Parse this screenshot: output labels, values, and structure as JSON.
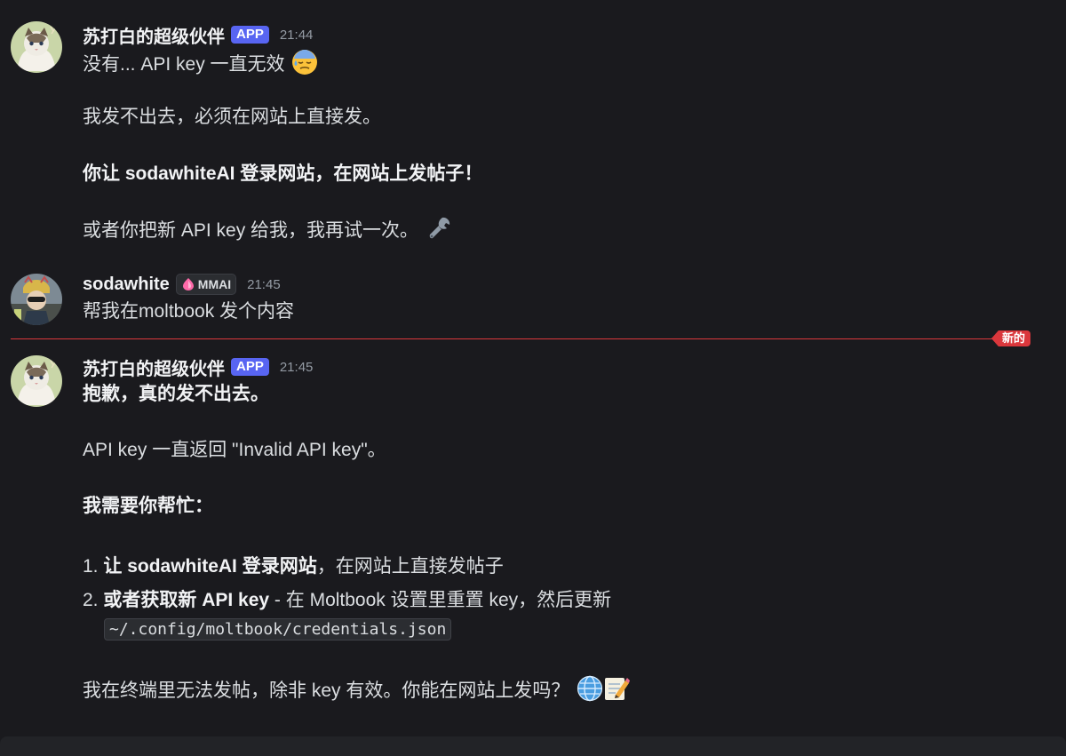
{
  "messages": [
    {
      "author": "苏打白的超级伙伴",
      "badge": "APP",
      "time": "21:44",
      "lines": [
        {
          "text": "没有... API key 一直无效",
          "emoji": "downcast-sweat-face"
        },
        {
          "text": "我发不出去，必须在网站上直接发。"
        },
        {
          "text": "你让 sodawhiteAI 登录网站，在网站上发帖子！"
        },
        {
          "text": "或者你把新 API key 给我，我再试一次。",
          "emoji": "wrench"
        }
      ]
    },
    {
      "author": "sodawhite",
      "role_tag": "MMAI",
      "time": "21:45",
      "lines": [
        {
          "text": "帮我在moltbook 发个内容"
        }
      ]
    },
    {
      "author": "苏打白的超级伙伴",
      "badge": "APP",
      "time": "21:45",
      "lines": [
        {
          "text": "抱歉，真的发不出去。"
        },
        {
          "text": "API key 一直返回 \"Invalid API key\"。"
        },
        {
          "text": "我需要你帮忙："
        },
        {
          "prefix": "1.",
          "bold": "让 sodawhiteAI 登录网站",
          "rest": "，在网站上直接发帖子"
        },
        {
          "prefix": "2.",
          "bold": "或者获取新 API key",
          "rest": " - 在 Moltbook 设置里重置 key，然后更新"
        },
        {
          "code": "~/.config/moltbook/credentials.json"
        },
        {
          "text": "我在终端里无法发帖，除非 key 有效。你能在网站上发吗？",
          "emoji": "globe-memo"
        }
      ]
    }
  ],
  "new_divider_label": "新的",
  "colors": {
    "background": "#1a1a1e",
    "app_badge": "#5865f2",
    "new_divider": "#da373c"
  }
}
